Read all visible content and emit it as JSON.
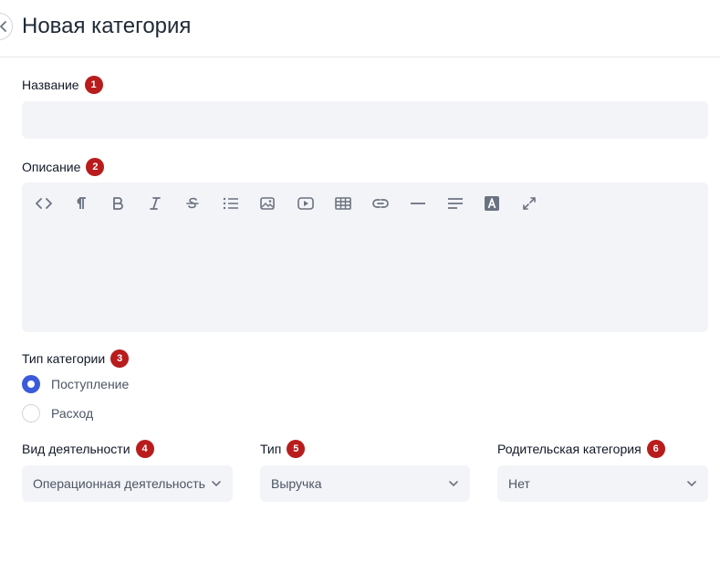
{
  "header": {
    "title": "Новая категория"
  },
  "form": {
    "name": {
      "label": "Название",
      "badge": "1",
      "value": ""
    },
    "description": {
      "label": "Описание",
      "badge": "2",
      "toolbar": [
        "code-view-icon",
        "paragraph-icon",
        "bold-icon",
        "italic-icon",
        "strikethrough-icon",
        "list-icon",
        "image-icon",
        "video-icon",
        "table-icon",
        "link-icon",
        "horizontal-rule-icon",
        "align-icon",
        "text-color-icon",
        "fullscreen-icon"
      ]
    },
    "category_type": {
      "label": "Тип категории",
      "badge": "3",
      "options": [
        {
          "label": "Поступление",
          "checked": true
        },
        {
          "label": "Расход",
          "checked": false
        }
      ]
    },
    "activity": {
      "label": "Вид деятельности",
      "badge": "4",
      "value": "Операционная деятельность"
    },
    "type": {
      "label": "Тип",
      "badge": "5",
      "value": "Выручка"
    },
    "parent": {
      "label": "Родительская категория",
      "badge": "6",
      "value": "Нет"
    }
  },
  "colors": {
    "accent": "#3b5bdb",
    "badge": "#b91c1c",
    "field_bg": "#f3f4f8",
    "icon": "#6b7280"
  }
}
